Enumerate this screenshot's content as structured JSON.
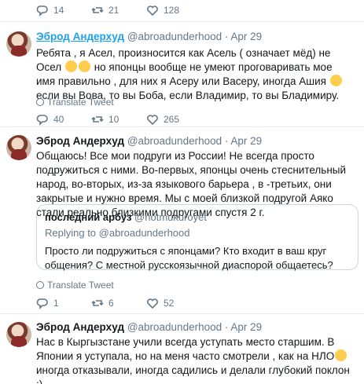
{
  "top_stats": {
    "replies": "14",
    "retweets": "21",
    "likes": "128"
  },
  "tweets": [
    {
      "name": "Эброд Андерхуд",
      "handle": "@abroadunderhood",
      "sep": "·",
      "date": "Apr 29",
      "text_1": "Ребята , я Асел, произносится как Асель ( означает мёд)  не Осел ",
      "text_2": " но японцы вообще не умеют проговаривать мое имя правильно , для них я Асеру или Васеру, иногда Ашия ",
      "text_3": " если вы Вова, то вы Боба, если Владимир, то вы Бладимиру.",
      "translate": "Translate Tweet",
      "replies": "40",
      "retweets": "10",
      "likes": "265"
    },
    {
      "name": "Эброд Андерхуд",
      "handle": "@abroadunderhood",
      "sep": "·",
      "date": "Apr 29",
      "text": "Общаюсь! Все мои подруги из России! Не всегда просто подружиться с ними. Во-первых, японцы очень стеснительный народ, во-вторых, из-за языкового барьера , в -третьих, они  закрытые и нужно время. Мы с моей  близкой подругой Аяко стали реально близкими подругами спустя 2 г.",
      "quote": {
        "name": "последний арбуз",
        "handle": "@notmukuroyet",
        "replying_prefix": "Replying to ",
        "replying_handle": "@abroadunderhood",
        "text": "Просто ли подружиться с японцами? Кто входит в ваш круг общения? С местной русскоязычной диаспорой общаетесь?"
      },
      "translate": "Translate Tweet",
      "replies": "1",
      "retweets": "6",
      "likes": "52"
    },
    {
      "name": "Эброд Андерхуд",
      "handle": "@abroadunderhood",
      "sep": "·",
      "date": "Apr 29",
      "text_1": "Нас в Кыргызстане учили всегда уступать место старшим. В Японии я уступала, но на меня часто смотрели , как на НЛО",
      "text_2": " иногда отказывали, иногда садились и делали глубокий поклон :)"
    }
  ],
  "icons": [
    "reply-icon",
    "retweet-icon",
    "like-icon",
    "globe-icon",
    "avatar"
  ],
  "colors": {
    "link": "#1da1f2",
    "muted": "#657786",
    "border": "#e6ecf0"
  }
}
